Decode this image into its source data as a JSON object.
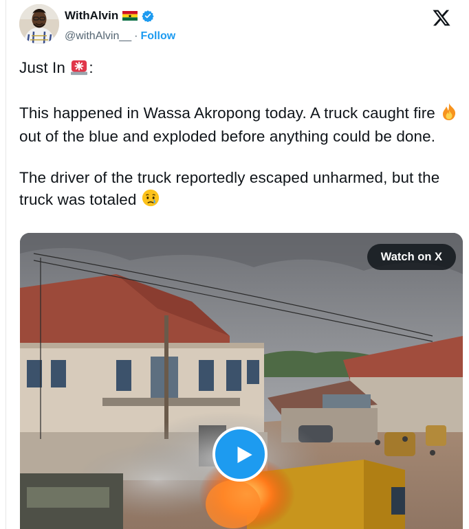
{
  "user": {
    "display_name": "WithAlvin",
    "handle": "@withAlvin__",
    "separator": "·",
    "follow_label": "Follow"
  },
  "tweet": {
    "line1_prefix": "Just In",
    "line1_suffix": ":",
    "para2_part1": "This happened in Wassa Akropong today. A truck caught fire",
    "para2_part2": " out of the blue and exploded before anything could be done.",
    "para3": "The driver of the truck reportedly escaped unharmed, but the truck was totaled"
  },
  "media": {
    "watch_label": "Watch on X"
  },
  "icons": {
    "platform": "x-logo-icon",
    "verified": "verified-badge-icon",
    "flag": "ghana-flag-icon",
    "siren": "siren-emoji",
    "fire": "fire-emoji",
    "crying": "crying-face-emoji",
    "play": "play-icon"
  },
  "colors": {
    "accent": "#1d9bf0",
    "text": "#0f1419",
    "secondary": "#536471"
  }
}
